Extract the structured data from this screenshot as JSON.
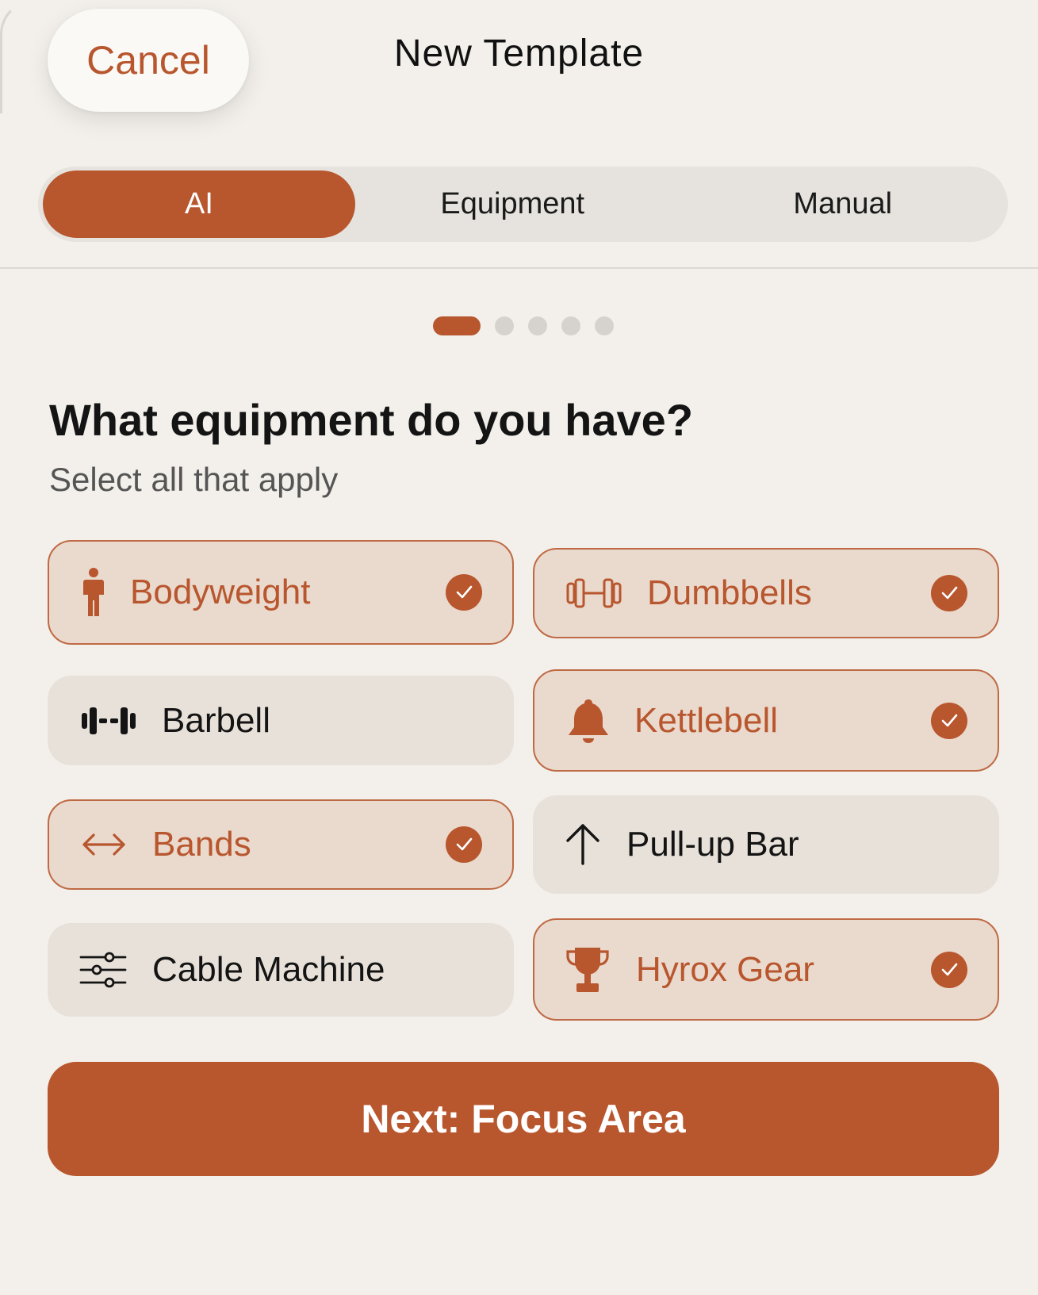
{
  "header": {
    "cancel_label": "Cancel",
    "title": "New Template"
  },
  "tabs": [
    {
      "label": "AI",
      "active": true
    },
    {
      "label": "Equipment",
      "active": false
    },
    {
      "label": "Manual",
      "active": false
    }
  ],
  "pager": {
    "total": 5,
    "current": 1
  },
  "question": {
    "title": "What equipment do you have?",
    "subtitle": "Select all that apply"
  },
  "options": [
    {
      "label": "Bodyweight",
      "icon": "person-icon",
      "selected": true
    },
    {
      "label": "Dumbbells",
      "icon": "dumbbell-icon",
      "selected": true
    },
    {
      "label": "Barbell",
      "icon": "barbell-icon",
      "selected": false
    },
    {
      "label": "Kettlebell",
      "icon": "bell-icon",
      "selected": true
    },
    {
      "label": "Bands",
      "icon": "left-right-arrow-icon",
      "selected": true
    },
    {
      "label": "Pull-up Bar",
      "icon": "up-arrow-icon",
      "selected": false
    },
    {
      "label": "Cable Machine",
      "icon": "sliders-icon",
      "selected": false
    },
    {
      "label": "Hyrox Gear",
      "icon": "trophy-icon",
      "selected": true
    }
  ],
  "next_button": {
    "label": "Next: Focus Area"
  },
  "colors": {
    "accent": "#b8562e",
    "background": "#f3f0eb",
    "option_bg": "#e7e1d9",
    "option_selected_bg": "#ead9cd"
  }
}
